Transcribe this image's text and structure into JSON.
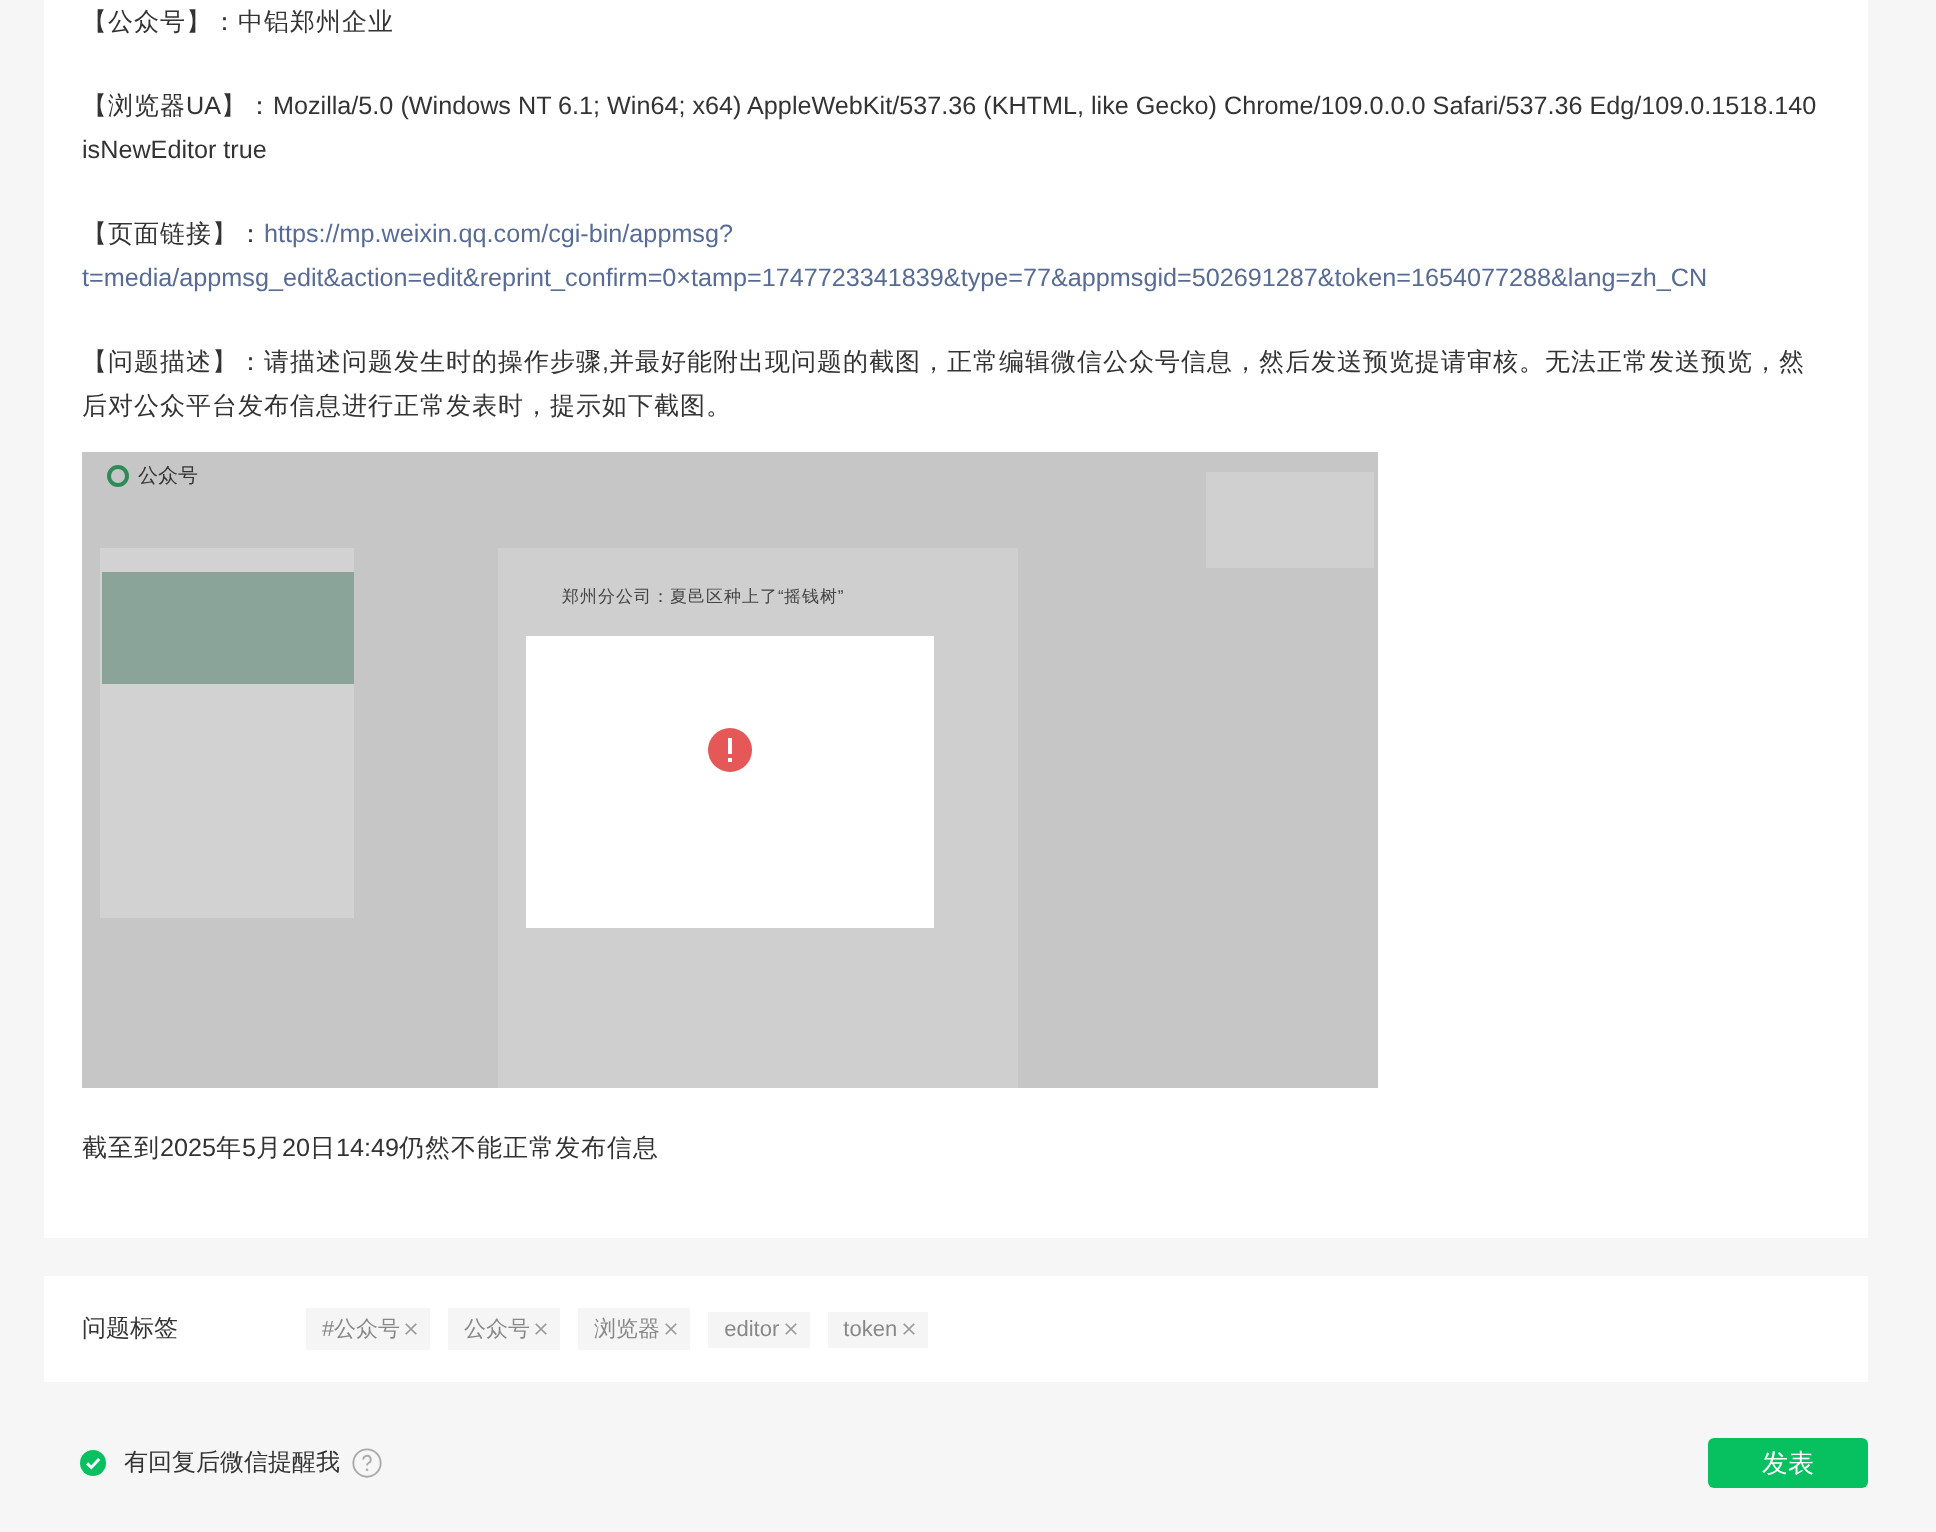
{
  "post": {
    "paragraphs": [
      {
        "kind": "text",
        "label": "【公众号】",
        "text": "：中铝郑州企业"
      },
      {
        "kind": "text",
        "label": "【浏览器UA】",
        "text": "：Mozilla/5.0 (Windows NT 6.1; Win64; x64) AppleWebKit/537.36 (KHTML, like Gecko) Chrome/109.0.0.0 Safari/537.36 Edg/109.0.1518.140 isNewEditor true"
      },
      {
        "kind": "link",
        "label": "【页面链接】",
        "text": "：",
        "links": [
          "https://mp.weixin.qq.com/cgi-bin/appmsg?",
          "t=media/appmsg_edit&action=edit&reprint_confirm=0×tamp=1747723341839&type=77&appmsgid=502691287&token=1654077288&lang=zh_CN"
        ]
      },
      {
        "kind": "text",
        "label": "【问题描述】",
        "text": "：请描述问题发生时的操作步骤,并最好能附出现问题的截图，正常编辑微信公众号信息，然后发送预览提请审核。无法正常发送预览，然后对公众平台发布信息进行正常发表时，提示如下截图。"
      }
    ],
    "screenshot": {
      "app_name": "公众号",
      "article_title": "郑州分公司：夏邑区种上了“摇钱树”"
    },
    "closing": "截至到2025年5月20日14:49仍然不能正常发布信息"
  },
  "tags": {
    "label": "问题标签",
    "items": [
      "#公众号",
      "公众号",
      "浏览器",
      "editor",
      "token"
    ]
  },
  "footer": {
    "notify": {
      "label": "有回复后微信提醒我",
      "checked": true
    },
    "submit": "发表"
  }
}
